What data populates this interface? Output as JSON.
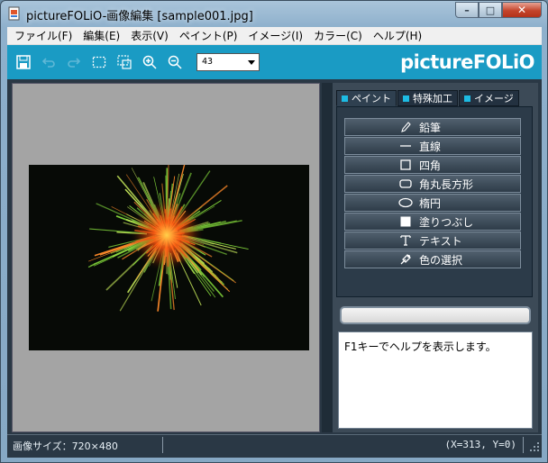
{
  "window": {
    "title": "pictureFOLiO-画像編集 [sample001.jpg]",
    "buttons": {
      "minimize": "–",
      "maximize": "□",
      "close": "✕"
    }
  },
  "menu": {
    "items": [
      "ファイル(F)",
      "編集(E)",
      "表示(V)",
      "ペイント(P)",
      "イメージ(I)",
      "カラー(C)",
      "ヘルプ(H)"
    ]
  },
  "toolbar": {
    "icons": [
      "save-icon",
      "undo-icon",
      "redo-icon",
      "select-rect-icon",
      "select-fit-icon",
      "zoom-in-icon",
      "zoom-out-icon"
    ],
    "zoom_value": "43",
    "logo": "pictureFOLiO"
  },
  "panel": {
    "tabs": [
      {
        "label": "ペイント",
        "active": true
      },
      {
        "label": "特殊加工",
        "active": false
      },
      {
        "label": "イメージ",
        "active": false
      }
    ],
    "tools": [
      {
        "label": "鉛筆",
        "icon": "pencil-icon"
      },
      {
        "label": "直線",
        "icon": "line-icon"
      },
      {
        "label": "四角",
        "icon": "rectangle-icon"
      },
      {
        "label": "角丸長方形",
        "icon": "rounded-rectangle-icon"
      },
      {
        "label": "楕円",
        "icon": "ellipse-icon"
      },
      {
        "label": "塗りつぶし",
        "icon": "fill-icon"
      },
      {
        "label": "テキスト",
        "icon": "text-icon"
      },
      {
        "label": "色の選択",
        "icon": "eyedropper-icon"
      }
    ],
    "status_field": "",
    "help_text": "F1キーでヘルプを表示します。"
  },
  "statusbar": {
    "image_size": "画像サイズ：720×480",
    "coords": "(X=313, Y=0)"
  },
  "colors": {
    "toolbar": "#1a9bc4",
    "panel": "#3c4a57",
    "tab_marker": "#1dbbe3"
  }
}
